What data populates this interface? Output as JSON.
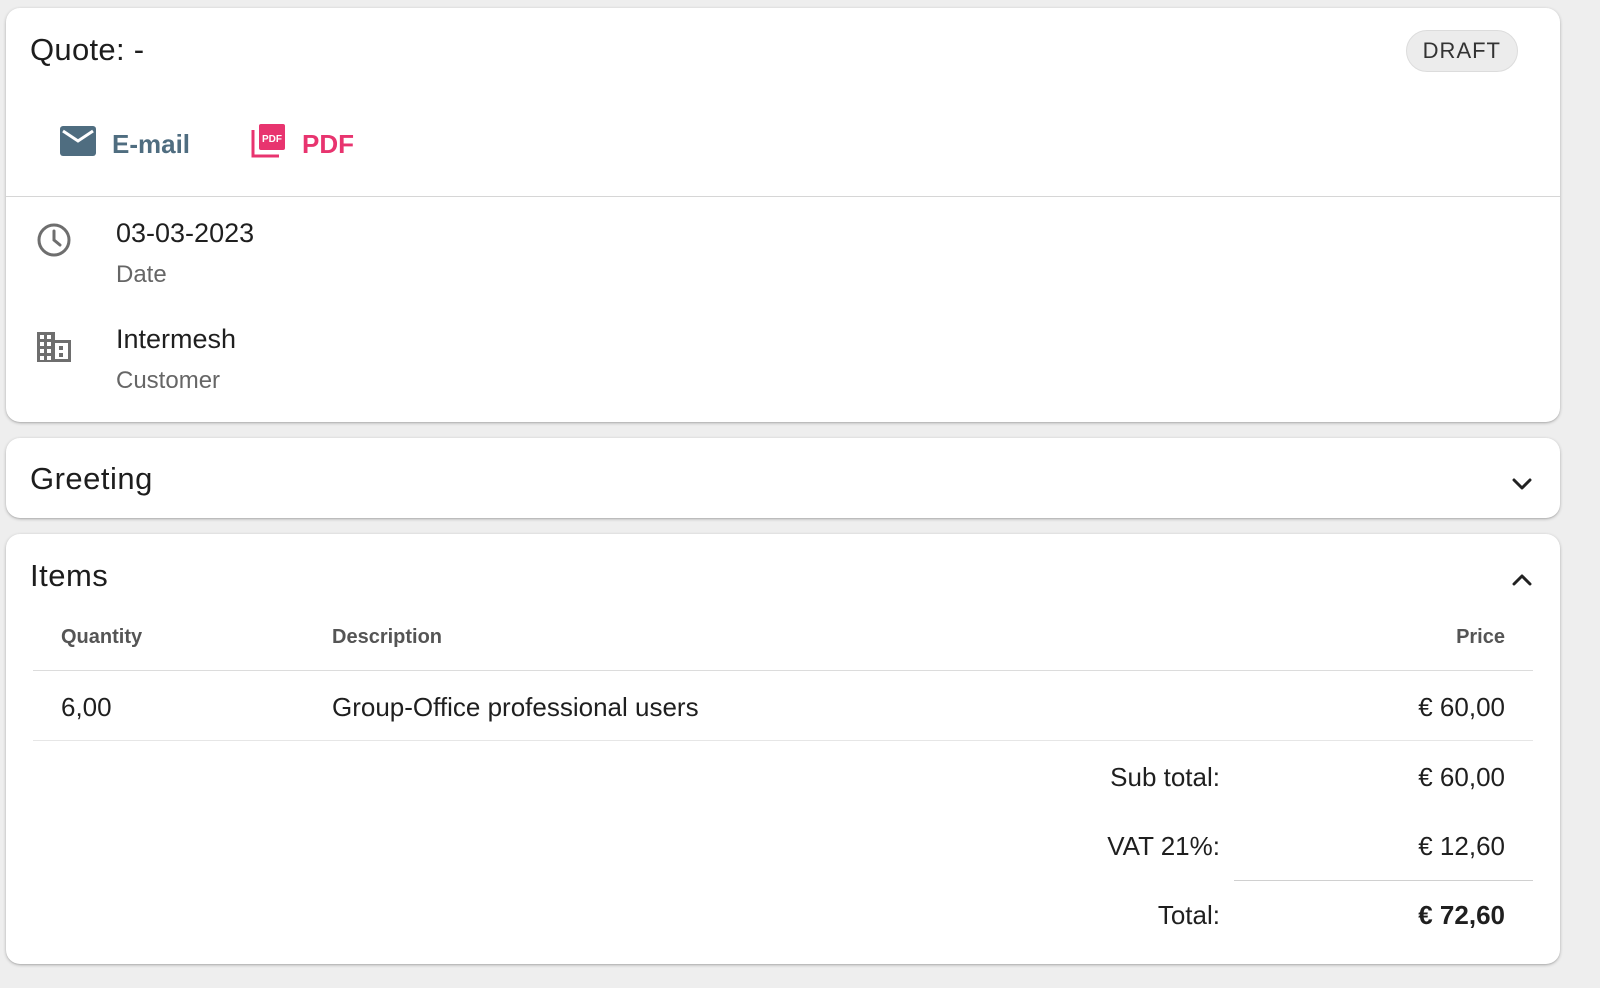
{
  "quote": {
    "title": "Quote: -",
    "status": "DRAFT",
    "actions": {
      "email_label": "E-mail",
      "pdf_label": "PDF",
      "pdf_icon_text": "PDF"
    },
    "fields": [
      {
        "icon": "clock-icon",
        "value": "03-03-2023",
        "label": "Date"
      },
      {
        "icon": "building-icon",
        "value": "Intermesh",
        "label": "Customer"
      }
    ]
  },
  "greeting": {
    "title": "Greeting",
    "expanded": false
  },
  "items": {
    "title": "Items",
    "expanded": true,
    "columns": {
      "quantity": "Quantity",
      "description": "Description",
      "price": "Price"
    },
    "rows": [
      {
        "quantity": "6,00",
        "description": "Group-Office professional users",
        "price": "€ 60,00"
      }
    ],
    "totals": {
      "subtotal_label": "Sub total:",
      "subtotal_value": "€ 60,00",
      "vat_label": "VAT 21%:",
      "vat_value": "€ 12,60",
      "total_label": "Total:",
      "total_value": "€ 72,60"
    }
  },
  "colors": {
    "email_accent": "#4f6d80",
    "pdf_accent": "#e8346f",
    "icon_gray": "#6e6e6e"
  }
}
